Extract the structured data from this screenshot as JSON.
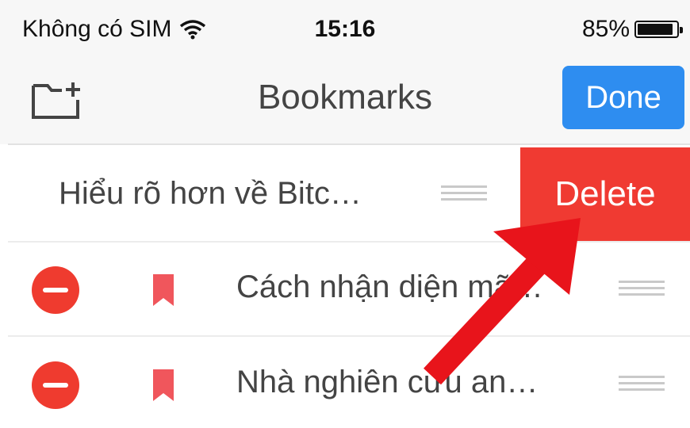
{
  "status_bar": {
    "carrier": "Không có SIM",
    "time": "15:16",
    "battery": "85%",
    "battery_level": 0.85
  },
  "nav_bar": {
    "title": "Bookmarks",
    "done_label": "Done",
    "accent_color": "#2e8df0"
  },
  "swiped_row": {
    "title": "Hiểu rõ hơn về Bitc…",
    "delete_label": "Delete",
    "delete_color": "#f03a32"
  },
  "rows": [
    {
      "title": "Cách nhận diện mã…"
    },
    {
      "title": "Nhà nghiên cứu an…"
    }
  ],
  "annotation": {
    "arrow_color": "#e8141b"
  }
}
